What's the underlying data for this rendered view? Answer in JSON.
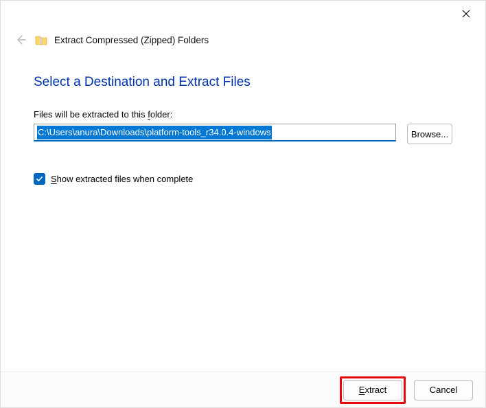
{
  "titlebar": {},
  "header": {
    "wizard_title": "Extract Compressed (Zipped) Folders"
  },
  "main": {
    "heading": "Select a Destination and Extract Files",
    "field_label_pre": "Files will be extracted to this ",
    "field_label_key": "f",
    "field_label_post": "older:",
    "path_value": "C:\\Users\\anura\\Downloads\\platform-tools_r34.0.4-windows",
    "browse_label": "Browse...",
    "checkbox_checked": true,
    "checkbox_label_key": "S",
    "checkbox_label_post": "how extracted files when complete"
  },
  "footer": {
    "extract_key": "E",
    "extract_post": "xtract",
    "cancel_label": "Cancel"
  }
}
